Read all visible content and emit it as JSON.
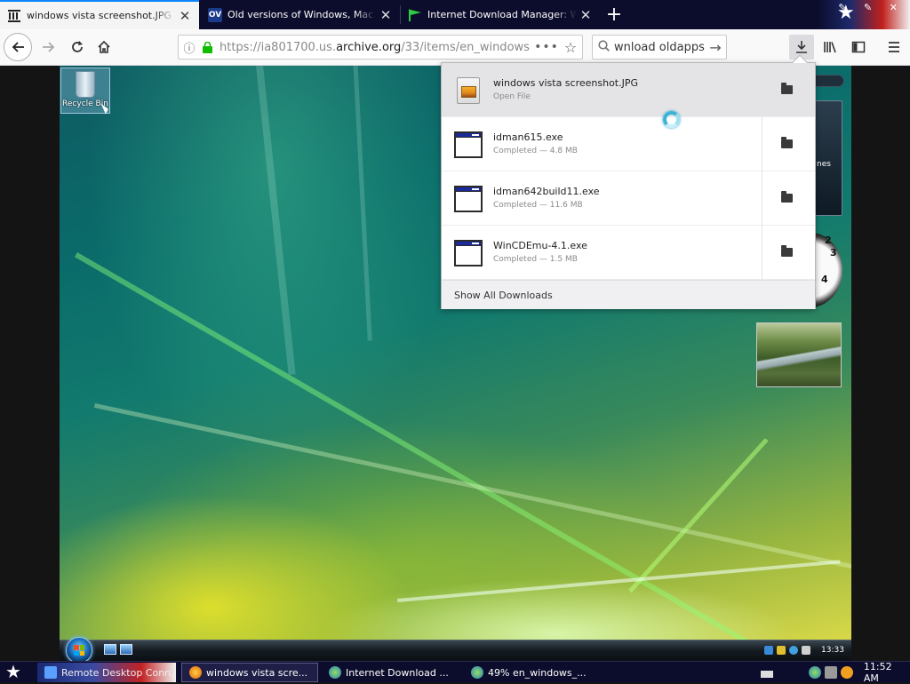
{
  "browser": {
    "tabs": [
      {
        "title": "windows vista screenshot.JPG (JPEG",
        "favicon": "archive-icon",
        "active": true
      },
      {
        "title": "Old versions of Windows, Mac and",
        "favicon": "ov-icon",
        "favicon_text": "OV",
        "active": false
      },
      {
        "title": "Internet Download Manager: Welco",
        "favicon": "idm-icon",
        "active": false
      }
    ],
    "new_tab": "+",
    "url": {
      "prefix": "https://ia801700.us.",
      "domain": "archive.org",
      "path": "/33/items/en_windows"
    },
    "search_query": "wnload oldapps",
    "colors": {
      "accent": "#0a84ff",
      "secure": "#12bc00",
      "tabstrip": "#0c0c2c"
    }
  },
  "downloads": {
    "items": [
      {
        "name": "windows vista screenshot.JPG",
        "status": "Open File",
        "type": "jpg",
        "selected": true
      },
      {
        "name": "idman615.exe",
        "status": "Completed — 4.8 MB",
        "type": "exe",
        "selected": false
      },
      {
        "name": "idman642build11.exe",
        "status": "Completed — 11.6 MB",
        "type": "exe",
        "selected": false
      },
      {
        "name": "WinCDEmu-4.1.exe",
        "status": "Completed — 1.5 MB",
        "type": "exe",
        "selected": false
      }
    ],
    "show_all": "Show All Downloads"
  },
  "desktop": {
    "recycle_bin": "Recycle Bin",
    "gadget_text": "nes",
    "clock_numbers": [
      "3",
      "2",
      "4"
    ]
  },
  "vista_taskbar": {
    "time": "13:33"
  },
  "host_taskbar": {
    "buttons": [
      {
        "label": "Remote Desktop Conn..."
      },
      {
        "label": "windows vista scre..."
      },
      {
        "label": "Internet Download ..."
      },
      {
        "label": "49% en_windows_..."
      }
    ],
    "time": "11:52 AM"
  }
}
